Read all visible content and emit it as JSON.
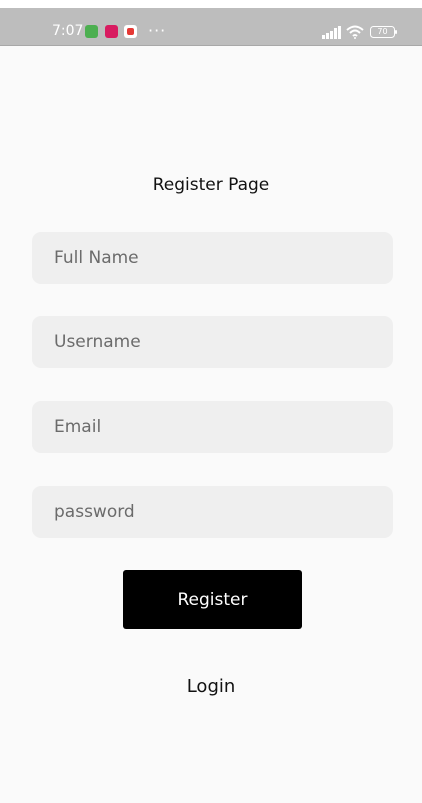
{
  "status_bar": {
    "time": "7:07",
    "more_indicator": "···",
    "battery_level": "70",
    "icons": [
      "android-notification-icon",
      "pink-app-notification-icon",
      "youtube-notification-icon",
      "signal-icon",
      "wifi-icon",
      "battery-icon"
    ]
  },
  "page": {
    "title": "Register Page"
  },
  "form": {
    "full_name": {
      "placeholder": "Full Name",
      "value": ""
    },
    "username": {
      "placeholder": "Username",
      "value": ""
    },
    "email": {
      "placeholder": "Email",
      "value": ""
    },
    "password": {
      "placeholder": "password",
      "value": ""
    },
    "register_label": "Register",
    "login_label": "Login"
  },
  "colors": {
    "background": "#fafafa",
    "status_bar": "#bdbdbd",
    "input_background": "#efefef",
    "button_background": "#000000",
    "button_text": "#ffffff"
  }
}
